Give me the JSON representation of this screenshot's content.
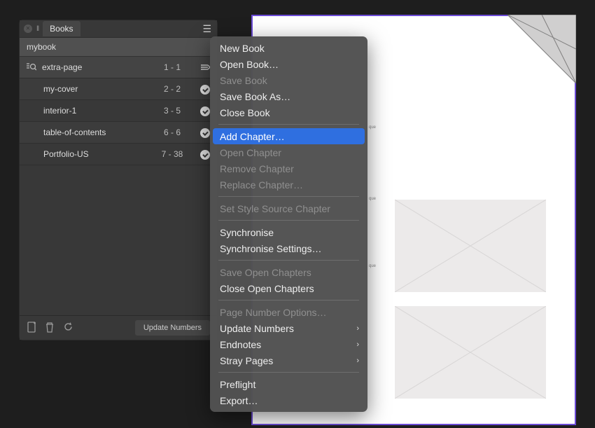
{
  "panel": {
    "tab_title": "Books",
    "book_name": "mybook",
    "chapters": [
      {
        "name": "extra-page",
        "pages": "1 - 1",
        "master_icon": true,
        "complete": false,
        "sync_icon": true
      },
      {
        "name": "my-cover",
        "pages": "2 - 2",
        "master_icon": false,
        "complete": true
      },
      {
        "name": "interior-1",
        "pages": "3 - 5",
        "master_icon": false,
        "complete": true
      },
      {
        "name": "table-of-contents",
        "pages": "6 - 6",
        "master_icon": false,
        "complete": true
      },
      {
        "name": "Portfolio-US",
        "pages": "7 - 38",
        "master_icon": false,
        "complete": true
      }
    ],
    "footer_button": "Update Numbers"
  },
  "menu": {
    "items": [
      {
        "label": "New Book",
        "enabled": true
      },
      {
        "label": "Open Book…",
        "enabled": true
      },
      {
        "label": "Save Book",
        "enabled": false
      },
      {
        "label": "Save Book As…",
        "enabled": true
      },
      {
        "label": "Close Book",
        "enabled": true
      },
      {
        "sep": true
      },
      {
        "label": "Add Chapter…",
        "enabled": true,
        "highlight": true
      },
      {
        "label": "Open Chapter",
        "enabled": false
      },
      {
        "label": "Remove Chapter",
        "enabled": false
      },
      {
        "label": "Replace Chapter…",
        "enabled": false
      },
      {
        "sep": true
      },
      {
        "label": "Set Style Source Chapter",
        "enabled": false
      },
      {
        "sep": true
      },
      {
        "label": "Synchronise",
        "enabled": true
      },
      {
        "label": "Synchronise Settings…",
        "enabled": true
      },
      {
        "sep": true
      },
      {
        "label": "Save Open Chapters",
        "enabled": false
      },
      {
        "label": "Close Open Chapters",
        "enabled": true
      },
      {
        "sep": true
      },
      {
        "label": "Page Number Options…",
        "enabled": false
      },
      {
        "label": "Update Numbers",
        "enabled": true,
        "submenu": true
      },
      {
        "label": "Endnotes",
        "enabled": true,
        "submenu": true
      },
      {
        "label": "Stray Pages",
        "enabled": true,
        "submenu": true
      },
      {
        "sep": true
      },
      {
        "label": "Preflight",
        "enabled": true
      },
      {
        "label": "Export…",
        "enabled": true
      }
    ]
  },
  "doc": {
    "placeholder_text": "que"
  }
}
